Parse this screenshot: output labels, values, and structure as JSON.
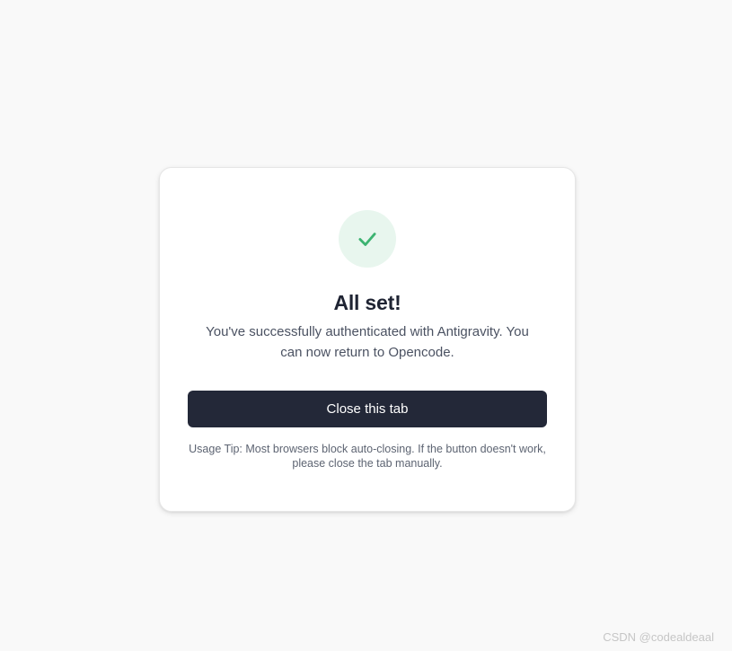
{
  "card": {
    "title": "All set!",
    "message": "You've successfully authenticated with Antigravity. You can now return to Opencode.",
    "button_label": "Close this tab",
    "tip": "Usage Tip: Most browsers block auto-closing. If the button doesn't work, please close the tab manually.",
    "icon": "check-icon",
    "colors": {
      "accent": "#3cb371",
      "badge_bg": "#e8f6ee",
      "button_bg": "#232838"
    }
  },
  "watermark": "CSDN @codealdeaal"
}
